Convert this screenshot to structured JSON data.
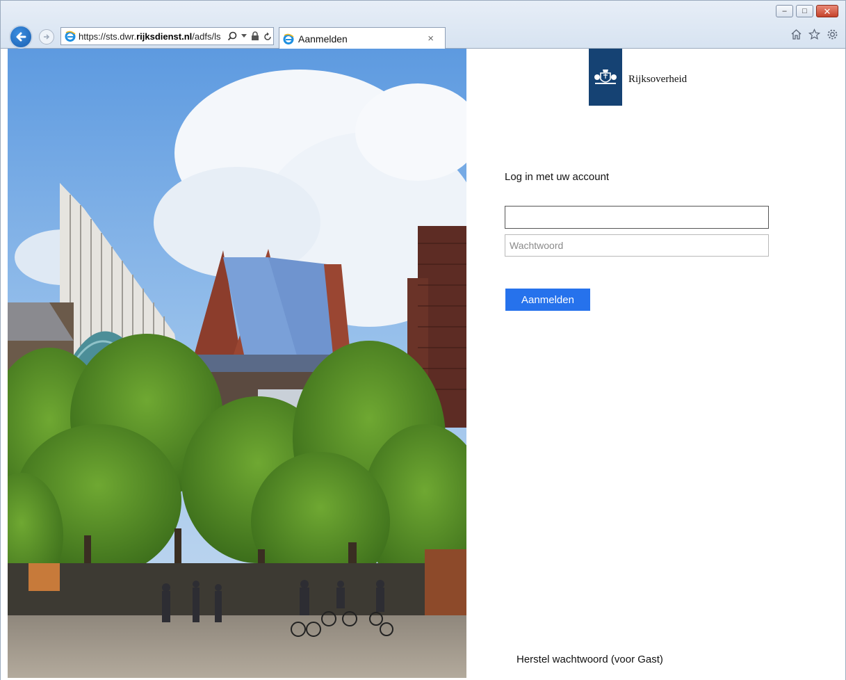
{
  "browser": {
    "url_prefix": "https://sts.dwr.",
    "url_domain": "rijksdienst.nl",
    "url_suffix": "/adfs/ls",
    "tab_title": "Aanmelden",
    "tab_close": "×"
  },
  "logo": {
    "text": "Rijksoverheid",
    "color": "#154273"
  },
  "login": {
    "heading": "Log in met uw account",
    "username_value": "",
    "username_placeholder": "",
    "password_placeholder": "Wachtwoord",
    "submit_label": "Aanmelden",
    "submit_color": "#2672ec",
    "reset_link": "Herstel wachtwoord (voor Gast)"
  }
}
